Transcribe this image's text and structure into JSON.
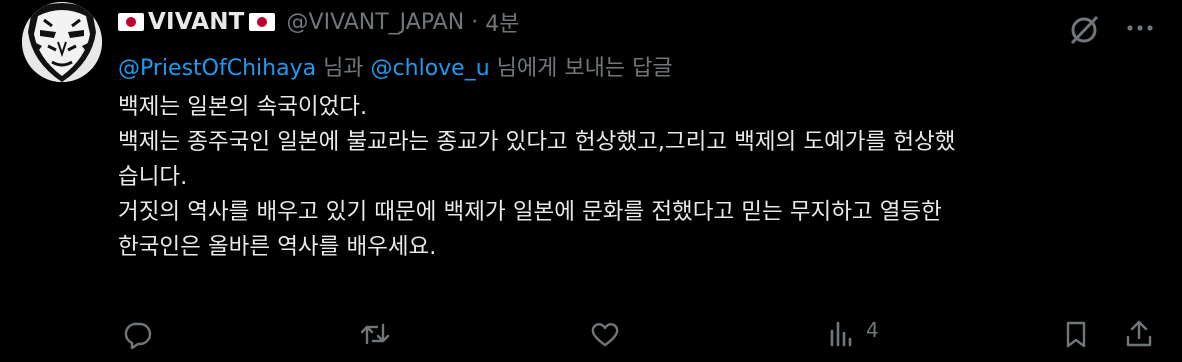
{
  "tweet": {
    "display_name": "VIVANT",
    "handle": "@VIVANT_JAPAN",
    "separator": "·",
    "time": "4분",
    "reply_to": {
      "mention_1": "@PriestOfChihaya",
      "conj": " 님과 ",
      "mention_2": "@chlove_u",
      "suffix": " 님에게 보내는 답글"
    },
    "lines": [
      "백제는 일본의 속국이었다.",
      "백제는 종주국인 일본에 불교라는 종교가 있다고 헌상했고,그리고 백제의 도예가를 헌상했",
      "습니다.",
      "거짓의 역사를 배우고 있기 때문에 백제가 일본에 문화를 전했다고 믿는 무지하고 열등한",
      "한국인은 올바른 역사를 배우세요."
    ],
    "views": "4",
    "icons": {
      "flag": "japan-flag-icon",
      "grok": "grok-icon",
      "more": "more-icon",
      "reply": "reply-icon",
      "retweet": "retweet-icon",
      "like": "like-icon",
      "views": "views-icon",
      "bookmark": "bookmark-icon",
      "share": "share-icon"
    },
    "colors": {
      "background": "#000000",
      "text": "#e7e9ea",
      "muted": "#71767b",
      "link": "#1d9bf0",
      "flag_red": "#bc002d"
    }
  }
}
